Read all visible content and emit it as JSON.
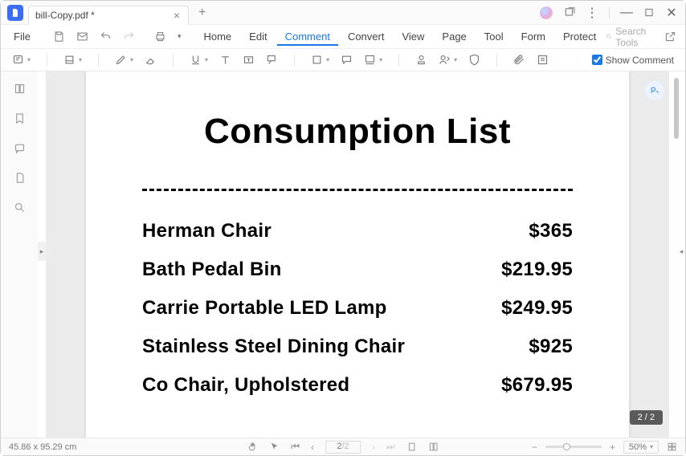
{
  "window": {
    "tab_title": "bill-Copy.pdf *",
    "search_placeholder": "Search Tools"
  },
  "menu": {
    "file": "File",
    "items": [
      "Home",
      "Edit",
      "Comment",
      "Convert",
      "View",
      "Page",
      "Tool",
      "Form",
      "Protect"
    ],
    "active_index": 2
  },
  "toolbar": {
    "show_comment_label": "Show Comment"
  },
  "document": {
    "title": "Consumption List",
    "items": [
      {
        "name": "Herman Chair",
        "price": "$365"
      },
      {
        "name": "Bath Pedal Bin",
        "price": "$219.95"
      },
      {
        "name": "Carrie Portable LED Lamp",
        "price": "$249.95"
      },
      {
        "name": "Stainless Steel Dining Chair",
        "price": "$925"
      },
      {
        "name": "Co Chair, Upholstered",
        "price": "$679.95"
      }
    ]
  },
  "status": {
    "dimensions": "45.86 x 95.29 cm",
    "page_current": "2",
    "page_total": "/2",
    "page_indicator": "2 / 2",
    "zoom": "50%"
  }
}
